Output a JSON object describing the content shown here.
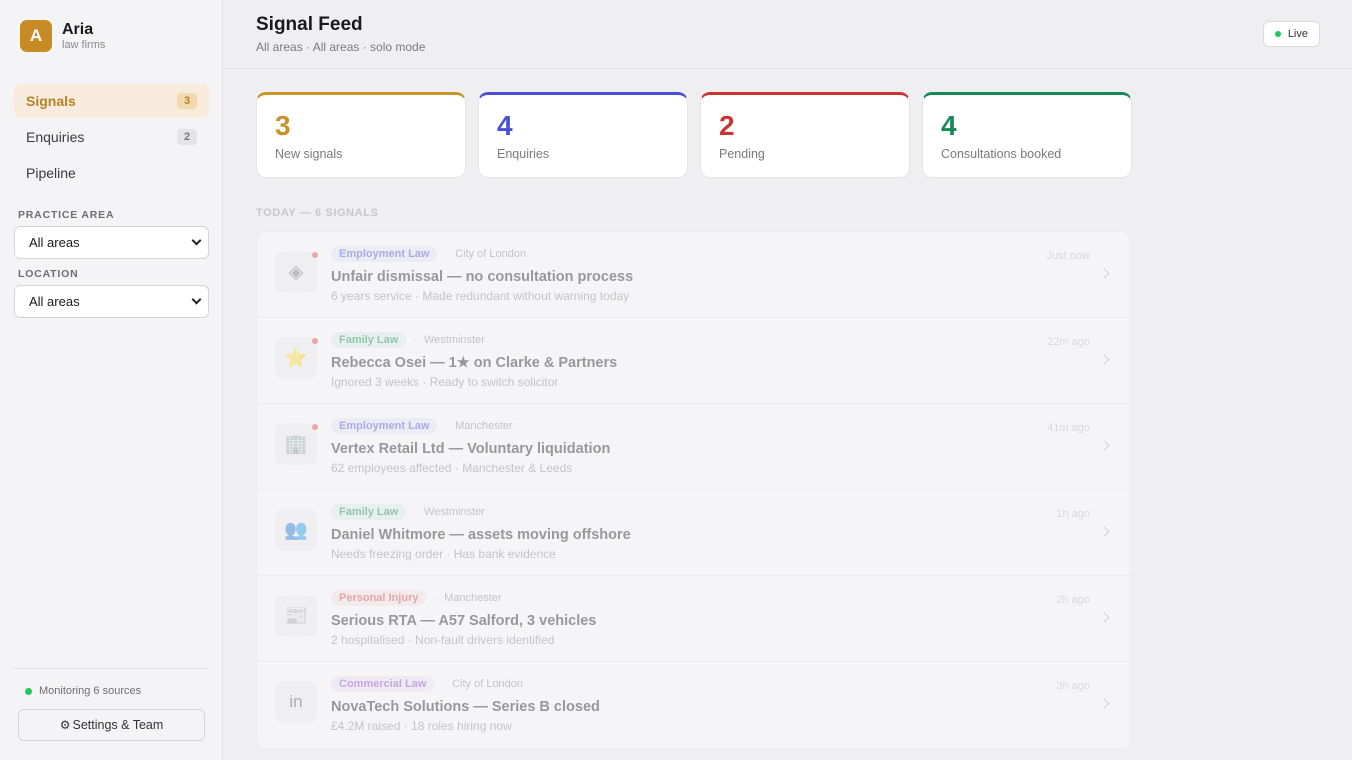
{
  "brand": {
    "initial": "A",
    "name": "Aria",
    "subtitle": "law firms"
  },
  "nav": [
    {
      "label": "Signals",
      "badge": "3",
      "active": true
    },
    {
      "label": "Enquiries",
      "badge": "2",
      "active": false
    },
    {
      "label": "Pipeline",
      "badge": "",
      "active": false
    }
  ],
  "filters": {
    "practice_area": {
      "label": "PRACTICE AREA",
      "value": "All areas"
    },
    "location": {
      "label": "LOCATION",
      "value": "All areas"
    }
  },
  "footer": {
    "monitor_text": "Monitoring 6 sources",
    "settings_label": "Settings & Team",
    "settings_icon": "⚙"
  },
  "header": {
    "title": "Signal Feed",
    "subtitle": "All areas · All areas · solo mode",
    "live_label": "Live"
  },
  "stats": [
    {
      "value": "3",
      "label": "New signals",
      "color": "#c8922c"
    },
    {
      "value": "4",
      "label": "Enquiries",
      "color": "#4b4fd6"
    },
    {
      "value": "2",
      "label": "Pending",
      "color": "#c93434"
    },
    {
      "value": "4",
      "label": "Consultations booked",
      "color": "#158a58"
    }
  ],
  "feed": {
    "section_label": "TODAY — 6 SIGNALS",
    "items": [
      {
        "icon": "◈",
        "icon_name": "diamond-icon",
        "unread": true,
        "tag": "Employment Law",
        "tag_color": "#4b4fd6",
        "tag_bg": "#e8e8fb",
        "location": "City of London",
        "title": "Unfair dismissal — no consultation process",
        "desc": "6 years service · Made redundant without warning today",
        "time": "Just now"
      },
      {
        "icon": "⭐",
        "icon_name": "star-icon",
        "unread": true,
        "tag": "Family Law",
        "tag_color": "#158a58",
        "tag_bg": "#def3e8",
        "location": "Westminster",
        "title": "Rebecca Osei — 1★ on Clarke & Partners",
        "desc": "Ignored 3 weeks · Ready to switch solicitor",
        "time": "22m ago"
      },
      {
        "icon": "🏢",
        "icon_name": "building-icon",
        "unread": true,
        "tag": "Employment Law",
        "tag_color": "#4b4fd6",
        "tag_bg": "#e8e8fb",
        "location": "Manchester",
        "title": "Vertex Retail Ltd — Voluntary liquidation",
        "desc": "62 employees affected · Manchester & Leeds",
        "time": "41m ago"
      },
      {
        "icon": "👥",
        "icon_name": "people-icon",
        "unread": false,
        "tag": "Family Law",
        "tag_color": "#158a58",
        "tag_bg": "#def3e8",
        "location": "Westminster",
        "title": "Daniel Whitmore — assets moving offshore",
        "desc": "Needs freezing order · Has bank evidence",
        "time": "1h ago"
      },
      {
        "icon": "📰",
        "icon_name": "newspaper-icon",
        "unread": false,
        "tag": "Personal Injury",
        "tag_color": "#d04545",
        "tag_bg": "#fbe3e3",
        "location": "Manchester",
        "title": "Serious RTA — A57 Salford, 3 vehicles",
        "desc": "2 hospitalised · Non-fault drivers identified",
        "time": "2h ago"
      },
      {
        "icon": "in",
        "icon_name": "linkedin-icon",
        "unread": false,
        "tag": "Commercial Law",
        "tag_color": "#8a44c8",
        "tag_bg": "#efe4f9",
        "location": "City of London",
        "title": "NovaTech Solutions — Series B closed",
        "desc": "£4.2M raised · 18 roles hiring now",
        "time": "3h ago"
      }
    ]
  }
}
